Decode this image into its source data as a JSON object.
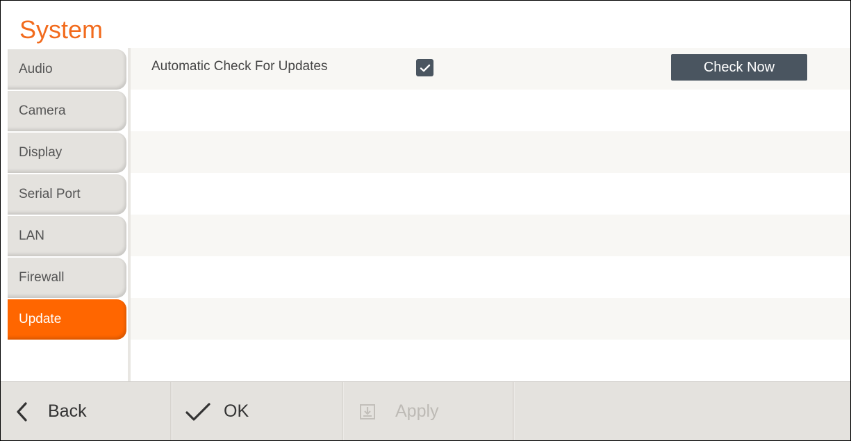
{
  "app": {
    "title": "System"
  },
  "sidebar": {
    "items": [
      {
        "label": "Audio",
        "active": false
      },
      {
        "label": "Camera",
        "active": false
      },
      {
        "label": "Display",
        "active": false
      },
      {
        "label": "Serial Port",
        "active": false
      },
      {
        "label": "LAN",
        "active": false
      },
      {
        "label": "Firewall",
        "active": false
      },
      {
        "label": "Update",
        "active": true
      }
    ]
  },
  "settings": {
    "auto_check_label": "Automatic Check For Updates",
    "auto_check_checked": true,
    "check_now_label": "Check Now"
  },
  "footer": {
    "back_label": "Back",
    "ok_label": "OK",
    "apply_label": "Apply",
    "apply_enabled": false
  },
  "colors": {
    "accent": "#ff6600",
    "title": "#f26b1d",
    "button_dark": "#4a5560",
    "sidebar_item": "#e4e2de"
  },
  "icons": {
    "back": "chevron-left-icon",
    "ok": "checkmark-icon",
    "apply": "apply-download-icon",
    "checkbox": "checkbox-checked-icon"
  }
}
